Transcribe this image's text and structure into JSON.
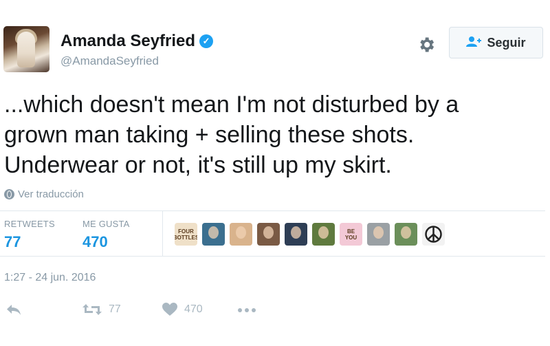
{
  "profile": {
    "name": "Amanda Seyfried",
    "handle": "@AmandaSeyfried",
    "verified": true
  },
  "follow_button": {
    "label": "Seguir",
    "icon": "add-user-icon"
  },
  "settings_icon": "gear-icon",
  "tweet": {
    "lines": [
      "...which doesn't mean I'm not disturbed by a",
      "grown man taking + selling these shots.",
      "Underwear or not, it's still up my skirt."
    ]
  },
  "translate": {
    "label": "Ver traducción",
    "icon": "globe-icon"
  },
  "stats": {
    "retweets_label": "RETWEETS",
    "retweets_value": "77",
    "likes_label": "ME GUSTA",
    "likes_value": "470"
  },
  "likers": [
    {
      "type": "text",
      "lines": [
        "FOUR",
        "BOTTLES"
      ],
      "color": "#efe0c8"
    },
    {
      "type": "photo",
      "color": "#3b6f8f"
    },
    {
      "type": "photo",
      "color": "#d9b38c"
    },
    {
      "type": "photo",
      "color": "#7a5a44"
    },
    {
      "type": "photo",
      "color": "#2e3e55"
    },
    {
      "type": "photo",
      "color": "#5f7a3e"
    },
    {
      "type": "text",
      "lines": [
        "BE",
        "YOU"
      ],
      "color": "#f3c9d6"
    },
    {
      "type": "photo",
      "color": "#9aa0a4"
    },
    {
      "type": "photo",
      "color": "#6b8f5a"
    },
    {
      "type": "peace",
      "color": "#f2f2f2"
    }
  ],
  "timestamp": "1:27 - 24 jun. 2016",
  "actions": {
    "reply_icon": "reply-icon",
    "retweet_icon": "retweet-icon",
    "retweet_count": "77",
    "like_icon": "heart-icon",
    "like_count": "470",
    "more_icon": "more-icon"
  },
  "colors": {
    "accent": "#1da1f2",
    "stat_value": "#1b95e0",
    "muted": "#8899a6",
    "border": "#e1e8ed"
  }
}
